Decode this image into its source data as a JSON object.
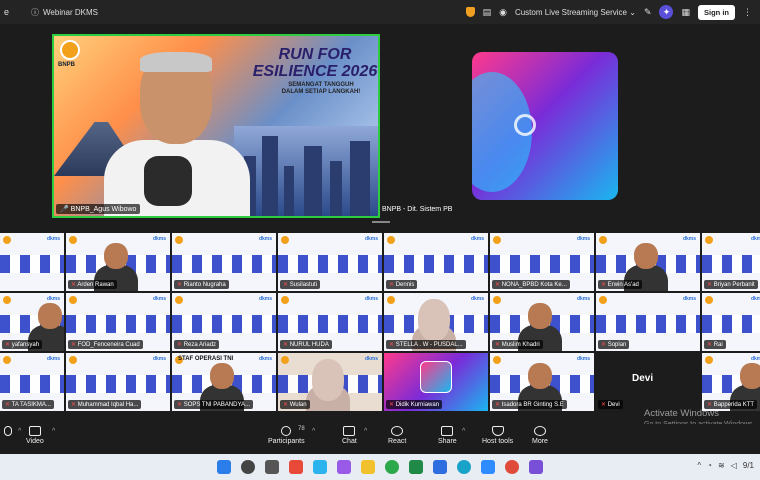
{
  "titlebar": {
    "meeting_title": "Webinar DKMS",
    "streaming_label": "Custom Live Streaming Service",
    "sign_in": "Sign in",
    "left_edge_char": "e"
  },
  "stage": {
    "banner_title": "RUN FOR\nESILIENCE 2026",
    "banner_subtitle": "SEMANGAT TANGGUH\nDALAM SETIAP LANGKAH!",
    "banner_org": "BNPB",
    "speaker_name": "BNPB_Agus Wibowo",
    "side_name": "BNPB - Dit. Sistem PB"
  },
  "gallery": {
    "tiles": [
      {
        "name": "",
        "style": "blank"
      },
      {
        "name": "Arden Rawan",
        "style": "person"
      },
      {
        "name": "Rianto Nugraha",
        "style": "blank"
      },
      {
        "name": "Susilastuti",
        "style": "blank"
      },
      {
        "name": "Dennis",
        "style": "blank"
      },
      {
        "name": "NONA_BPBD Kota Ke...",
        "style": "blank"
      },
      {
        "name": "Erwin As'ad",
        "style": "person"
      },
      {
        "name": "Briyan Perbanit",
        "style": "blank"
      },
      {
        "name": "yafansyah",
        "style": "person"
      },
      {
        "name": "FOD_Fenceneira Cuad",
        "style": "blank"
      },
      {
        "name": "Reza Ariadz",
        "style": "blank"
      },
      {
        "name": "NURUL HUDA",
        "style": "blank"
      },
      {
        "name": "STELLA . W - PUSDAL...",
        "style": "hijab"
      },
      {
        "name": "Muslim Khadri",
        "style": "person"
      },
      {
        "name": "Soplan",
        "style": "blank"
      },
      {
        "name": "Rai",
        "style": "blank"
      },
      {
        "name": "TA TASIKMA...",
        "style": "blank"
      },
      {
        "name": "Muhammad Iqbal Ha...",
        "style": "blank"
      },
      {
        "name": "SOPS TNI PABANDYA...",
        "style": "staf"
      },
      {
        "name": "Wulan",
        "style": "hijab"
      },
      {
        "name": "Didik Kurniawan",
        "style": "grad"
      },
      {
        "name": "Isadora BR Ginting S.E",
        "style": "person"
      },
      {
        "name": "Devi",
        "style": "devi"
      },
      {
        "name": "Bapperida KTT",
        "style": "person"
      }
    ],
    "staf_label": "STAF OPERASI TNI",
    "devi_display": "Devi"
  },
  "watermark": {
    "line1": "Activate Windows",
    "line2": "Go to Settings to activate Windows."
  },
  "toolbar": {
    "video": "Video",
    "participants": "Participants",
    "participant_count": "78",
    "chat": "Chat",
    "react": "React",
    "share": "Share",
    "host_tools": "Host tools",
    "more": "More"
  },
  "taskbar": {
    "clock": "9/1"
  }
}
